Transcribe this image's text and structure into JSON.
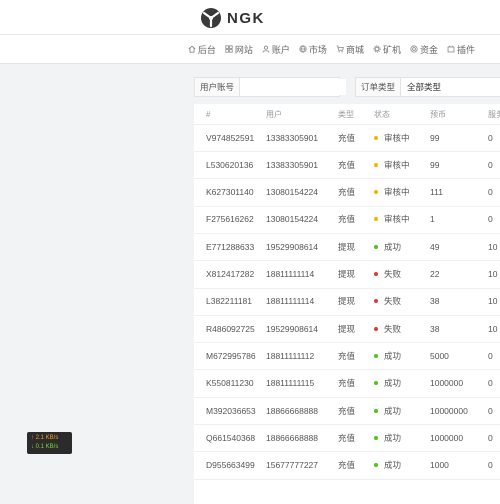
{
  "brand": {
    "name": "NGK"
  },
  "nav": [
    {
      "label": "后台",
      "icon": "home-icon"
    },
    {
      "label": "网站",
      "icon": "grid-icon"
    },
    {
      "label": "账户",
      "icon": "user-icon"
    },
    {
      "label": "市场",
      "icon": "globe-icon"
    },
    {
      "label": "商城",
      "icon": "cart-icon"
    },
    {
      "label": "矿机",
      "icon": "gear-icon"
    },
    {
      "label": "资金",
      "icon": "coin-icon"
    },
    {
      "label": "插件",
      "icon": "plugin-icon"
    }
  ],
  "filters": {
    "user_account_label": "用户账号",
    "user_account_value": "",
    "order_type_label": "订单类型",
    "order_type_value": "全部类型"
  },
  "table": {
    "headers": [
      "#",
      "用户",
      "类型",
      "状态",
      "预币",
      "服务"
    ],
    "rows": [
      {
        "id": "V974852591",
        "user": "13383305901",
        "type": "充值",
        "status": "审核中",
        "status_color": "#f5b400",
        "amount": "99",
        "service": "0"
      },
      {
        "id": "L530620136",
        "user": "13383305901",
        "type": "充值",
        "status": "审核中",
        "status_color": "#f5b400",
        "amount": "99",
        "service": "0"
      },
      {
        "id": "K627301140",
        "user": "13080154224",
        "type": "充值",
        "status": "审核中",
        "status_color": "#f5b400",
        "amount": "111",
        "service": "0"
      },
      {
        "id": "F275616262",
        "user": "13080154224",
        "type": "充值",
        "status": "审核中",
        "status_color": "#f5b400",
        "amount": "1",
        "service": "0"
      },
      {
        "id": "E771288633",
        "user": "19529908614",
        "type": "提现",
        "status": "成功",
        "status_color": "#52c41a",
        "amount": "49",
        "service": "10"
      },
      {
        "id": "X812417282",
        "user": "18811111114",
        "type": "提现",
        "status": "失败",
        "status_color": "#e03a3a",
        "amount": "22",
        "service": "10"
      },
      {
        "id": "L382211181",
        "user": "18811111114",
        "type": "提现",
        "status": "失败",
        "status_color": "#e03a3a",
        "amount": "38",
        "service": "10"
      },
      {
        "id": "R486092725",
        "user": "19529908614",
        "type": "提现",
        "status": "失败",
        "status_color": "#e03a3a",
        "amount": "38",
        "service": "10"
      },
      {
        "id": "M672995786",
        "user": "18811111112",
        "type": "充值",
        "status": "成功",
        "status_color": "#52c41a",
        "amount": "5000",
        "service": "0"
      },
      {
        "id": "K550811230",
        "user": "18811111115",
        "type": "充值",
        "status": "成功",
        "status_color": "#52c41a",
        "amount": "1000000",
        "service": "0"
      },
      {
        "id": "M392036653",
        "user": "18866668888",
        "type": "充值",
        "status": "成功",
        "status_color": "#52c41a",
        "amount": "10000000",
        "service": "0"
      },
      {
        "id": "Q661540368",
        "user": "18866668888",
        "type": "充值",
        "status": "成功",
        "status_color": "#52c41a",
        "amount": "1000000",
        "service": "0"
      },
      {
        "id": "D955663499",
        "user": "15677777227",
        "type": "充值",
        "status": "成功",
        "status_color": "#52c41a",
        "amount": "1000",
        "service": "0"
      }
    ]
  },
  "net_speed": {
    "upload": "↑ 2.1 KB/s",
    "download": "↓ 0.1 KB/s"
  }
}
